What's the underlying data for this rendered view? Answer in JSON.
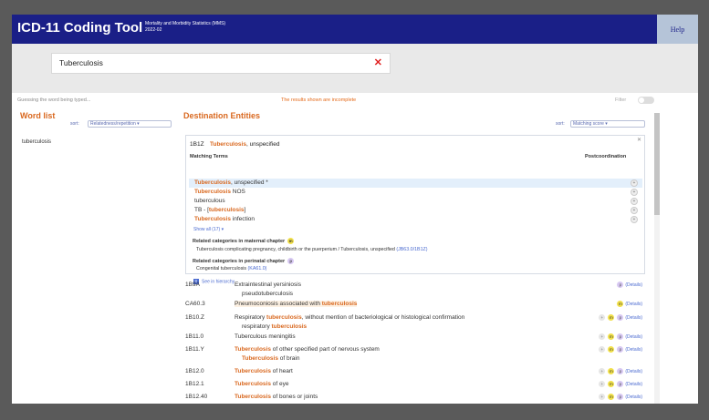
{
  "colors": {
    "header_bg": "#1a1f87",
    "accent": "#d9681f",
    "help_bg": "#b5c4d8",
    "link": "#4a6ad0"
  },
  "header": {
    "title": "ICD-11 Coding Tool",
    "subtitle_line1": "Mortality and Morbidity Statistics (MMS)",
    "subtitle_line2": "2022-02",
    "help": "Help"
  },
  "search": {
    "value": "Tuberculosis",
    "clear_icon": "close-icon"
  },
  "status": {
    "guessing": "Guessing the word being typed...",
    "incomplete": "The results shown are incomplete",
    "filter": "Filter"
  },
  "word_list": {
    "title": "Word list",
    "sort_label": "sort:",
    "sort_value": "Relatedness/repetition",
    "items": [
      "tuberculosis"
    ]
  },
  "destination": {
    "title": "Destination Entities",
    "sort_label": "sort:",
    "sort_value": "Matching score",
    "card": {
      "code": "1B1Z",
      "title_hl": "Tuberculosis",
      "title_rest": ", unspecified",
      "matching_terms_label": "Matching Terms",
      "postcoordination_label": "Postcoordination",
      "terms": [
        {
          "hl": "Tuberculosis",
          "rest": ", unspecified *"
        },
        {
          "hl": "Tuberculosis",
          "rest": " NOS"
        },
        {
          "pre": "tuberculous"
        },
        {
          "pre": "TB - [",
          "hl": "tuberculosis",
          "rest": "]"
        },
        {
          "hl": "Tuberculosis",
          "rest": " infection"
        }
      ],
      "show_all": "Show all (17) ▾",
      "maternal_label": "Related categories in maternal chapter",
      "maternal_text": "Tuberculosis complicating pregnancy, childbirth or the puerperium / Tuberculosis, unspecified",
      "maternal_link": "(JB63.0/1B1Z)",
      "perinatal_label": "Related categories in perinatal chapter",
      "perinatal_text": "Congenital tuberculosis",
      "perinatal_link": "(KA61.0)",
      "hierarchy": "See in hierarchy"
    },
    "results": [
      {
        "code": "1B9A",
        "title_pre": "Extraintestinal yersiniosis",
        "title_hl": "",
        "title_rest": "",
        "sub_pre": "pseudotuberculosis",
        "sub_hl": "",
        "sub_rest": "",
        "details": "(Details)"
      },
      {
        "code": "CA60.3",
        "title_pre": "Pneumoconiosis associated with ",
        "title_hl": "tuberculosis",
        "title_rest": "",
        "sub_pre": "",
        "sub_hl": "",
        "sub_rest": "",
        "details": "(Details)"
      },
      {
        "code": "1B10.Z",
        "title_pre": "Respiratory ",
        "title_hl": "tuberculosis",
        "title_rest": ", without mention of bacteriological or histological confirmation",
        "sub_pre": "respiratory ",
        "sub_hl": "tuberculosis",
        "sub_rest": "",
        "details": "(Details)"
      },
      {
        "code": "1B11.0",
        "title_pre": "Tuberculous meningitis",
        "title_hl": "",
        "title_rest": "",
        "sub_pre": "",
        "sub_hl": "",
        "sub_rest": "",
        "details": "(Details)"
      },
      {
        "code": "1B11.Y",
        "title_pre": "",
        "title_hl": "Tuberculosis",
        "title_rest": " of other specified part of nervous system",
        "sub_pre": "",
        "sub_hl": "Tuberculosis",
        "sub_rest": " of brain",
        "details": "(Details)"
      },
      {
        "code": "1B12.0",
        "title_pre": "",
        "title_hl": "Tuberculosis",
        "title_rest": " of heart",
        "sub_pre": "",
        "sub_hl": "",
        "sub_rest": "",
        "details": "(Details)"
      },
      {
        "code": "1B12.1",
        "title_pre": "",
        "title_hl": "Tuberculosis",
        "title_rest": " of eye",
        "sub_pre": "",
        "sub_hl": "",
        "sub_rest": "",
        "details": "(Details)"
      },
      {
        "code": "1B12.40",
        "title_pre": "",
        "title_hl": "Tuberculosis",
        "title_rest": " of bones or joints",
        "sub_pre": "",
        "sub_hl": "",
        "sub_rest": "",
        "details": "(Details)"
      }
    ]
  }
}
